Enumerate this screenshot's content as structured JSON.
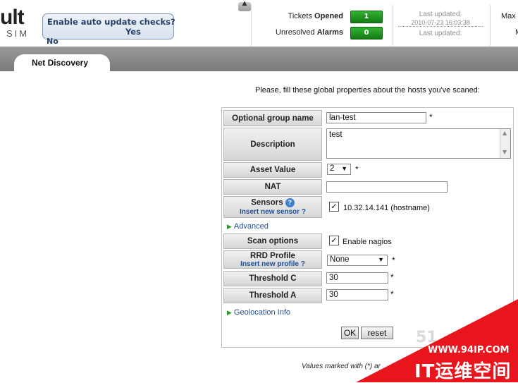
{
  "logo": {
    "text": "ult",
    "sub": "SIM"
  },
  "update_prompt": {
    "question": "Enable auto update checks?",
    "yes": "Yes",
    "no": "No"
  },
  "header": {
    "collapse_icon": "up-arrow-icon",
    "stats": [
      {
        "label_prefix": "Tickets",
        "label_bold": "Opened",
        "count": "1"
      },
      {
        "label_prefix": "Unresolved",
        "label_bold": "Alarms",
        "count": "0"
      }
    ],
    "last_updated_label": "Last updated:",
    "last_updated_date": "2010-07-23 16:03:38",
    "last_updated_label2": "Last updated:",
    "max_label": "Max",
    "max_value": "M"
  },
  "tabs": [
    {
      "label": "Net Discovery",
      "active": true
    }
  ],
  "form": {
    "intro": "Please, fill these global properties about the hosts you've scaned:",
    "group_name": {
      "label": "Optional group name",
      "value": "lan-test",
      "required": "*"
    },
    "description": {
      "label": "Description",
      "value": "test"
    },
    "asset_value": {
      "label": "Asset Value",
      "value": "2",
      "required": "*"
    },
    "nat": {
      "label": "NAT",
      "value": ""
    },
    "sensors": {
      "label": "Sensors",
      "help_icon": "help-icon",
      "insert_link": "Insert new sensor ?",
      "item": "10.32.14.141 (hostname)",
      "checked": true
    },
    "advanced_link": "Advanced",
    "scan_options": {
      "label": "Scan options",
      "checkbox_label": "Enable nagios",
      "checked": true
    },
    "rrd_profile": {
      "label": "RRD Profile",
      "insert_link": "Insert new profile ?",
      "value": "None",
      "required": "*"
    },
    "threshold_c": {
      "label": "Threshold C",
      "value": "30",
      "required": "*"
    },
    "threshold_a": {
      "label": "Threshold A",
      "value": "30",
      "required": "*"
    },
    "geolocation_link": "Geolocation Info",
    "ok_button": "OK",
    "reset_button": "reset"
  },
  "footer_note": "Values marked with (*) ar",
  "watermark": {
    "digits": "51",
    "url": "WWW.94IP.COM",
    "name": "IT运维空间",
    "color": "#e8161c"
  },
  "colors": {
    "badge_green": "#1e9a1e",
    "tab_bar": "#8a8a8a",
    "link_blue": "#1f4f94"
  }
}
